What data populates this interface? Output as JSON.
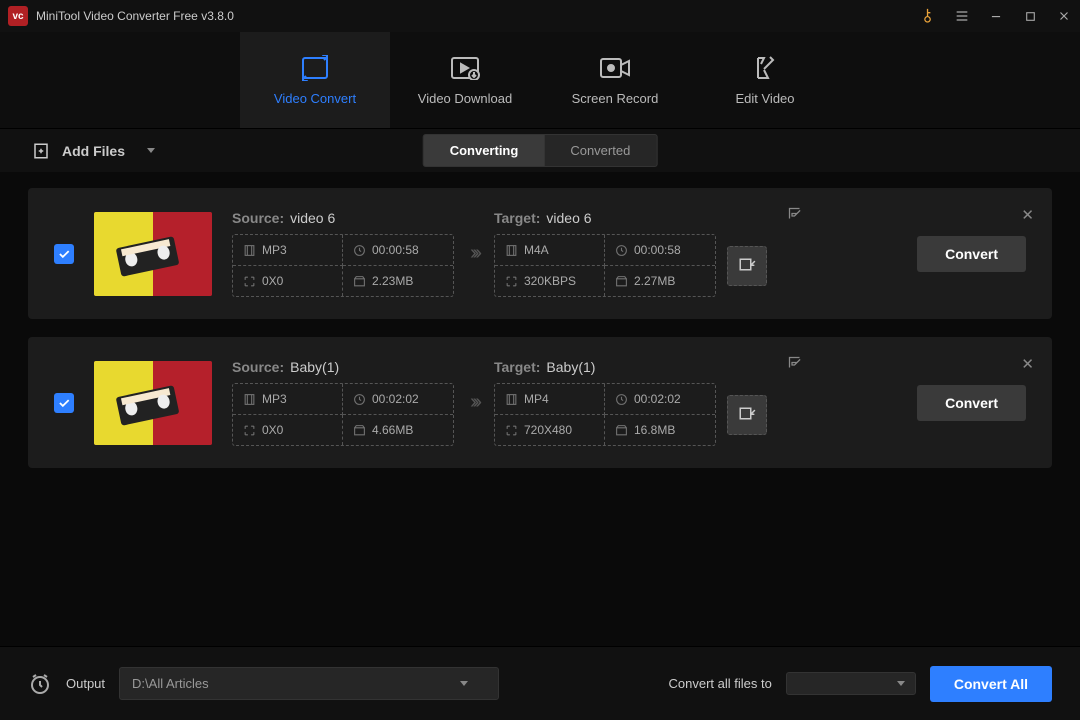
{
  "app": {
    "title": "MiniTool Video Converter Free v3.8.0",
    "logo_text": "vc"
  },
  "main_tabs": [
    {
      "label": "Video Convert",
      "icon": "convert-icon"
    },
    {
      "label": "Video Download",
      "icon": "download-icon"
    },
    {
      "label": "Screen Record",
      "icon": "record-icon"
    },
    {
      "label": "Edit Video",
      "icon": "edit-video-icon"
    }
  ],
  "toolbar": {
    "add_files": "Add Files",
    "tab_converting": "Converting",
    "tab_converted": "Converted"
  },
  "rows": [
    {
      "source_label": "Source:",
      "source_name": "video 6",
      "target_label": "Target:",
      "target_name": "video 6",
      "source": {
        "format": "MP3",
        "duration": "00:00:58",
        "resolution": "0X0",
        "size": "2.23MB"
      },
      "target": {
        "format": "M4A",
        "duration": "00:00:58",
        "resolution": "320KBPS",
        "size": "2.27MB"
      },
      "thumb": {
        "left": "#e8d92f",
        "right": "#b5202b"
      },
      "convert": "Convert"
    },
    {
      "source_label": "Source:",
      "source_name": "Baby(1)",
      "target_label": "Target:",
      "target_name": "Baby(1)",
      "source": {
        "format": "MP3",
        "duration": "00:02:02",
        "resolution": "0X0",
        "size": "4.66MB"
      },
      "target": {
        "format": "MP4",
        "duration": "00:02:02",
        "resolution": "720X480",
        "size": "16.8MB"
      },
      "thumb": {
        "left": "#e8d92f",
        "right": "#b5202b"
      },
      "convert": "Convert"
    }
  ],
  "footer": {
    "output_label": "Output",
    "output_path": "D:\\All Articles",
    "convert_all_label": "Convert all files to",
    "convert_all_btn": "Convert All"
  }
}
